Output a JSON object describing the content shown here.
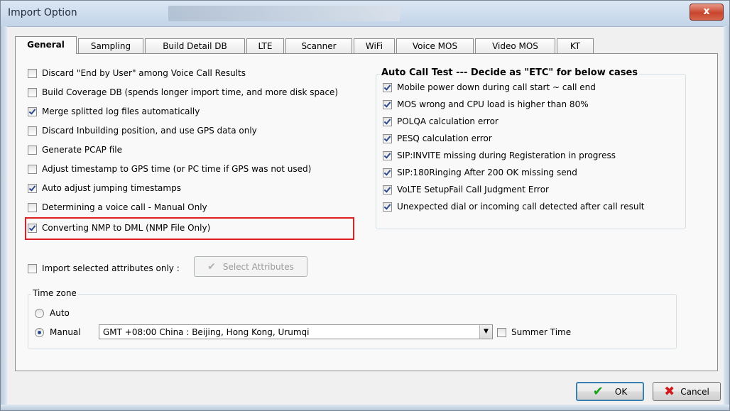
{
  "window": {
    "title": "Import Option",
    "close_label": "x"
  },
  "tabs": [
    {
      "label": "General"
    },
    {
      "label": "Sampling"
    },
    {
      "label": "Build Detail DB"
    },
    {
      "label": "LTE"
    },
    {
      "label": "Scanner"
    },
    {
      "label": "WiFi"
    },
    {
      "label": "Voice MOS"
    },
    {
      "label": "Video MOS"
    },
    {
      "label": "KT"
    }
  ],
  "general": {
    "options": [
      {
        "label": "Discard \"End by User\" among Voice Call Results",
        "checked": false
      },
      {
        "label": "Build Coverage DB (spends longer import time, and more disk space)",
        "checked": false
      },
      {
        "label": "Merge splitted log files automatically",
        "checked": true
      },
      {
        "label": "Discard Inbuilding position, and use GPS data only",
        "checked": false
      },
      {
        "label": "Generate PCAP file",
        "checked": false
      },
      {
        "label": "Adjust timestamp to GPS time (or PC time if GPS was not used)",
        "checked": false
      },
      {
        "label": "Auto adjust jumping timestamps",
        "checked": true
      },
      {
        "label": "Determining a voice call - Manual Only",
        "checked": false
      },
      {
        "label": "Converting NMP to DML (NMP File  Only)",
        "checked": true
      }
    ],
    "auto_call": {
      "title": "Auto Call Test --- Decide as \"ETC\" for below cases",
      "options": [
        {
          "label": "Mobile power down during call start ~ call end",
          "checked": true
        },
        {
          "label": "MOS wrong and CPU load is higher than 80%",
          "checked": true
        },
        {
          "label": "POLQA calculation error",
          "checked": true
        },
        {
          "label": "PESQ calculation error",
          "checked": true
        },
        {
          "label": "SIP:INVITE missing during Registeration in progress",
          "checked": true
        },
        {
          "label": "SIP:180Ringing After 200 OK missing send",
          "checked": true
        },
        {
          "label": "VoLTE SetupFail Call Judgment Error",
          "checked": true
        },
        {
          "label": "Unexpected dial or incoming call detected after call result",
          "checked": true
        }
      ]
    },
    "import_selected": {
      "label": "Import selected attributes only :",
      "checked": false
    },
    "select_attributes_label": "Select Attributes",
    "timezone": {
      "title": "Time zone",
      "auto_label": "Auto",
      "manual_label": "Manual",
      "selected": "manual",
      "value": "GMT +08:00 China : Beijing, Hong Kong, Urumqi",
      "summer_label": "Summer Time",
      "summer_checked": false
    }
  },
  "footer": {
    "ok_label": "OK",
    "cancel_label": "Cancel"
  },
  "colors": {
    "highlight": "#e02020",
    "ok_icon": "#1aa31a",
    "cancel_icon": "#d01c1c"
  }
}
